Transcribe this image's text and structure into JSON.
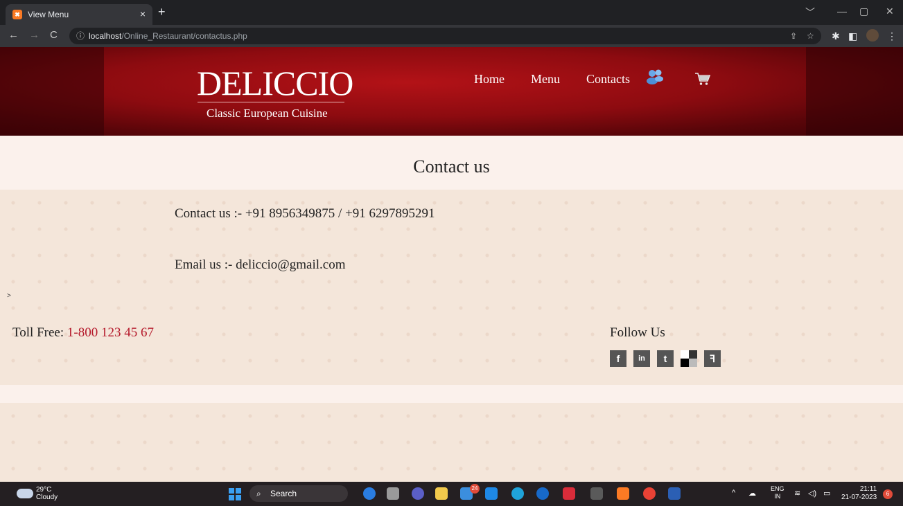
{
  "browser": {
    "tab_title": "View Menu",
    "tab_close": "×",
    "new_tab": "+",
    "url_host": "localhost",
    "url_path": "/Online_Restaurant/contactus.php",
    "window_controls": [
      "﹀",
      "—",
      "▢",
      "✕"
    ]
  },
  "header": {
    "logo": "DELICCIO",
    "tagline": "Classic European Cuisine",
    "menu": [
      "Home",
      "Menu",
      "Contacts"
    ]
  },
  "page": {
    "title": "Contact us",
    "contact_line": "Contact us :- +91 8956349875 / +91 6297895291",
    "email_line": "Email us :- deliccio@gmail.com",
    "stray_char": ">",
    "toll_free_label": "Toll Free:",
    "toll_free_number": "1-800 123 45 67",
    "follow_label": "Follow Us",
    "social": [
      "facebook",
      "linkedin",
      "twitter",
      "delicious",
      "stumbleupon"
    ]
  },
  "taskbar": {
    "temperature": "29°C",
    "weather": "Cloudy",
    "search": "Search",
    "badge": "24",
    "lang_top": "ENG",
    "lang_bottom": "IN",
    "time": "21:11",
    "date": "21-07-2023",
    "notifications": "6"
  },
  "colors": {
    "header_red": "#9a0d12",
    "toll_free_number": "#b5192b",
    "page_bg": "#f4e6da"
  }
}
